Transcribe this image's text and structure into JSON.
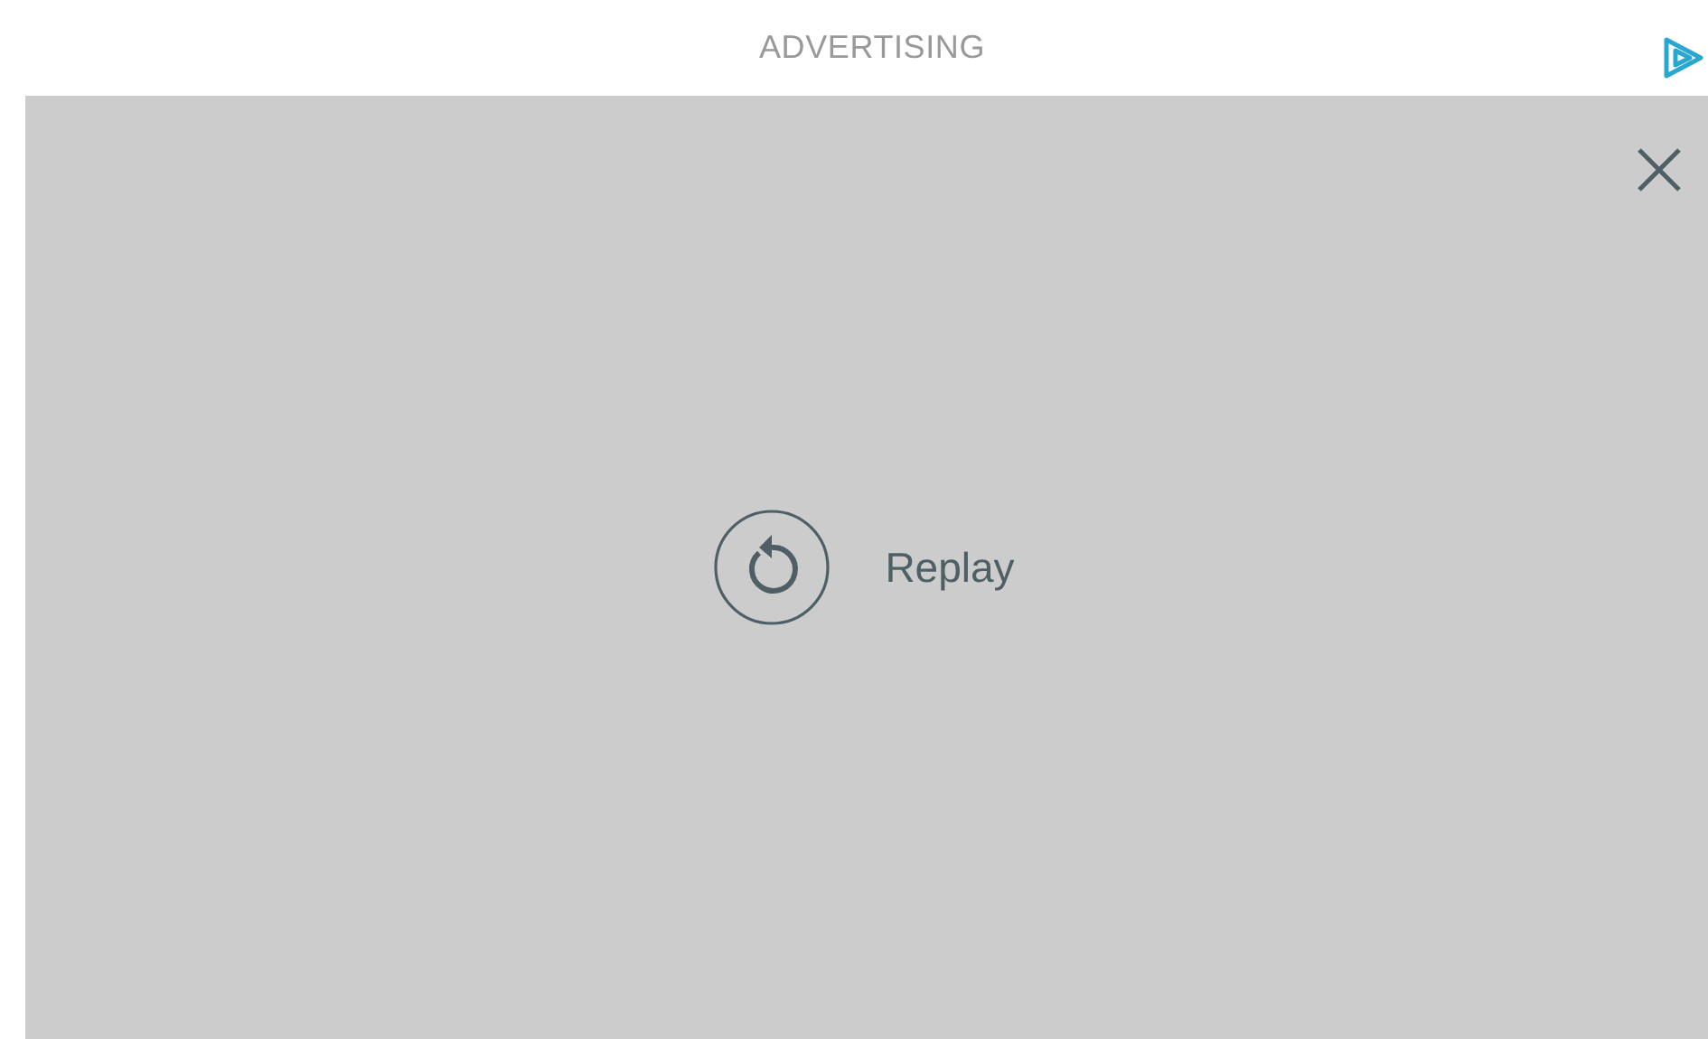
{
  "header": {
    "label": "ADVERTISING"
  },
  "player": {
    "replay_label": "Replay"
  }
}
